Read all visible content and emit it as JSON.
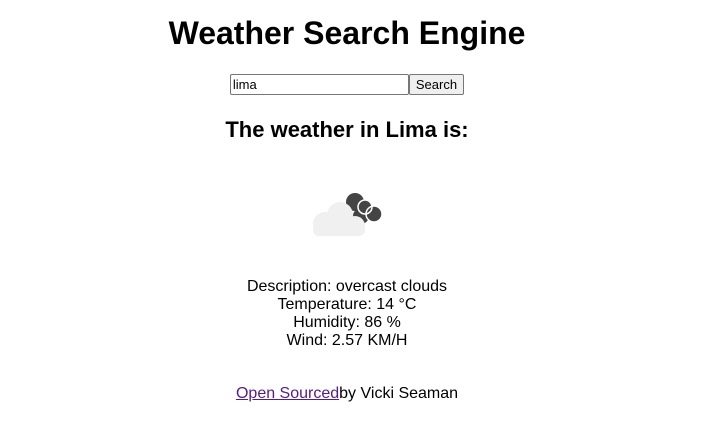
{
  "header": {
    "title": "Weather Search Engine"
  },
  "search": {
    "value": "lima",
    "button_label": "Search"
  },
  "result": {
    "heading": "The weather in Lima is:",
    "icon": "overcast-clouds-icon",
    "description_label": "Description: ",
    "description": "overcast clouds",
    "temperature_label": "Temperature: ",
    "temperature": "14 °C",
    "humidity_label": "Humidity: ",
    "humidity": "86 %",
    "wind_label": "Wind: ",
    "wind": "2.57 KM/H"
  },
  "footer": {
    "link_text": "Open Sourced",
    "author_text": "by Vicki Seaman",
    "link_color": "#551a8b"
  },
  "colors": {
    "cloud_light": "#f0f0f0",
    "cloud_dark": "#444444"
  }
}
